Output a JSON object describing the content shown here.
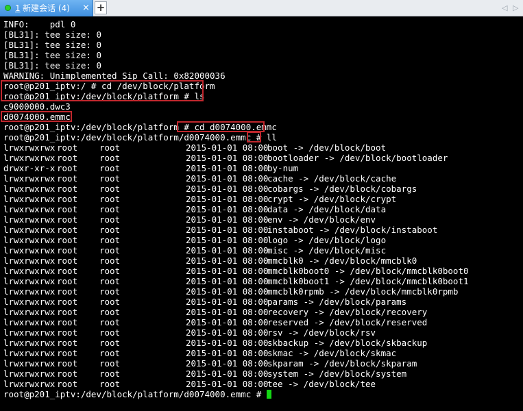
{
  "tab": {
    "number": "1",
    "title": "新建会话 (4)",
    "close": "×",
    "add": "+",
    "prev": "◁",
    "next": "▷"
  },
  "terminal": {
    "lines_top": [
      "INFO:    pdl 0",
      "[BL31]: tee size: 0",
      "[BL31]: tee size: 0",
      "[BL31]: tee size: 0",
      "[BL31]: tee size: 0",
      "WARNING: Unimplemented Sip Call: 0x82000036",
      "root@p201_iptv:/ # cd /dev/block/platform",
      "root@p201_iptv:/dev/block/platform # ls",
      "c9000000.dwc3",
      "d0074000.emmc",
      "root@p201_iptv:/dev/block/platform # cd d0074000.emmc",
      "root@p201_iptv:/dev/block/platform/d0074000.emmc # ll"
    ],
    "listing": [
      {
        "perm": "lrwxrwxrwx",
        "owner": "root",
        "group": "root",
        "date": "2015-01-01 08:00",
        "name": "boot -> /dev/block/boot"
      },
      {
        "perm": "lrwxrwxrwx",
        "owner": "root",
        "group": "root",
        "date": "2015-01-01 08:00",
        "name": "bootloader -> /dev/block/bootloader"
      },
      {
        "perm": "drwxr-xr-x",
        "owner": "root",
        "group": "root",
        "date": "2015-01-01 08:00",
        "name": "by-num"
      },
      {
        "perm": "lrwxrwxrwx",
        "owner": "root",
        "group": "root",
        "date": "2015-01-01 08:00",
        "name": "cache -> /dev/block/cache"
      },
      {
        "perm": "lrwxrwxrwx",
        "owner": "root",
        "group": "root",
        "date": "2015-01-01 08:00",
        "name": "cobargs -> /dev/block/cobargs"
      },
      {
        "perm": "lrwxrwxrwx",
        "owner": "root",
        "group": "root",
        "date": "2015-01-01 08:00",
        "name": "crypt -> /dev/block/crypt"
      },
      {
        "perm": "lrwxrwxrwx",
        "owner": "root",
        "group": "root",
        "date": "2015-01-01 08:00",
        "name": "data -> /dev/block/data"
      },
      {
        "perm": "lrwxrwxrwx",
        "owner": "root",
        "group": "root",
        "date": "2015-01-01 08:00",
        "name": "env -> /dev/block/env"
      },
      {
        "perm": "lrwxrwxrwx",
        "owner": "root",
        "group": "root",
        "date": "2015-01-01 08:00",
        "name": "instaboot -> /dev/block/instaboot"
      },
      {
        "perm": "lrwxrwxrwx",
        "owner": "root",
        "group": "root",
        "date": "2015-01-01 08:00",
        "name": "logo -> /dev/block/logo"
      },
      {
        "perm": "lrwxrwxrwx",
        "owner": "root",
        "group": "root",
        "date": "2015-01-01 08:00",
        "name": "misc -> /dev/block/misc"
      },
      {
        "perm": "lrwxrwxrwx",
        "owner": "root",
        "group": "root",
        "date": "2015-01-01 08:00",
        "name": "mmcblk0 -> /dev/block/mmcblk0"
      },
      {
        "perm": "lrwxrwxrwx",
        "owner": "root",
        "group": "root",
        "date": "2015-01-01 08:00",
        "name": "mmcblk0boot0 -> /dev/block/mmcblk0boot0"
      },
      {
        "perm": "lrwxrwxrwx",
        "owner": "root",
        "group": "root",
        "date": "2015-01-01 08:00",
        "name": "mmcblk0boot1 -> /dev/block/mmcblk0boot1"
      },
      {
        "perm": "lrwxrwxrwx",
        "owner": "root",
        "group": "root",
        "date": "2015-01-01 08:00",
        "name": "mmcblk0rpmb -> /dev/block/mmcblk0rpmb"
      },
      {
        "perm": "lrwxrwxrwx",
        "owner": "root",
        "group": "root",
        "date": "2015-01-01 08:00",
        "name": "params -> /dev/block/params"
      },
      {
        "perm": "lrwxrwxrwx",
        "owner": "root",
        "group": "root",
        "date": "2015-01-01 08:00",
        "name": "recovery -> /dev/block/recovery"
      },
      {
        "perm": "lrwxrwxrwx",
        "owner": "root",
        "group": "root",
        "date": "2015-01-01 08:00",
        "name": "reserved -> /dev/block/reserved"
      },
      {
        "perm": "lrwxrwxrwx",
        "owner": "root",
        "group": "root",
        "date": "2015-01-01 08:00",
        "name": "rsv -> /dev/block/rsv"
      },
      {
        "perm": "lrwxrwxrwx",
        "owner": "root",
        "group": "root",
        "date": "2015-01-01 08:00",
        "name": "skbackup -> /dev/block/skbackup"
      },
      {
        "perm": "lrwxrwxrwx",
        "owner": "root",
        "group": "root",
        "date": "2015-01-01 08:00",
        "name": "skmac -> /dev/block/skmac"
      },
      {
        "perm": "lrwxrwxrwx",
        "owner": "root",
        "group": "root",
        "date": "2015-01-01 08:00",
        "name": "skparam -> /dev/block/skparam"
      },
      {
        "perm": "lrwxrwxrwx",
        "owner": "root",
        "group": "root",
        "date": "2015-01-01 08:00",
        "name": "system -> /dev/block/system"
      },
      {
        "perm": "lrwxrwxrwx",
        "owner": "root",
        "group": "root",
        "date": "2015-01-01 08:00",
        "name": "tee -> /dev/block/tee"
      }
    ],
    "final_prompt": "root@p201_iptv:/dev/block/platform/d0074000.emmc # "
  },
  "colors": {
    "background": "#000000",
    "text": "#ffffff",
    "highlight_box": "#c0272d",
    "cursor": "#14d614",
    "tab_active": "#3f8fdf",
    "status_dot": "#2bd12b"
  }
}
